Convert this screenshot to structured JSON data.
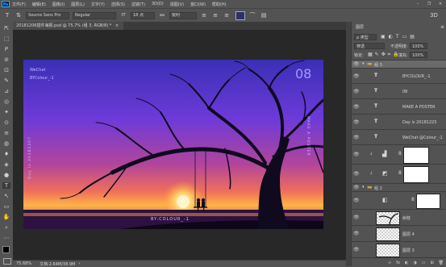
{
  "app": {
    "logo": "Ps"
  },
  "menu": [
    "文件(F)",
    "编辑(E)",
    "图像(I)",
    "图层(L)",
    "文字(Y)",
    "选择(S)",
    "滤镜(T)",
    "3D(D)",
    "视图(V)",
    "窗口(W)",
    "帮助(H)"
  ],
  "window_controls": [
    "–",
    "❐",
    "✕"
  ],
  "options": {
    "tool_icon": "type-tool-icon",
    "font_family": "Source Sans Pro",
    "font_style": "Regular",
    "font_size": "18 点",
    "antialias": "锐利",
    "color_swatch": "#2b2f6b"
  },
  "document_tab": {
    "title": "20181206插件海报.psd @ 75.7% (组 3, RGB/8) *",
    "close": "×"
  },
  "tools": [
    "⇱",
    "⬚",
    "ᑭ",
    "⊘",
    "⊡",
    "✎",
    "⊿",
    "◎",
    "✦",
    "⊙",
    "≡",
    "◍",
    "♦",
    "◈",
    "●",
    "T",
    "↖",
    "▭",
    "✋",
    "⌕",
    "⋯"
  ],
  "poster": {
    "wechat": "WeChat",
    "credit": "BYColour_-1",
    "number": "08",
    "vertical_right": "MAKE A POSTER",
    "vertical_left": "Day is 20181207",
    "bottom_credit": "BY:COLOUR_-1"
  },
  "status": {
    "zoom": "75.68%",
    "doc": "文档:2.64M/38.9M",
    "arrow": "›"
  },
  "layers_panel": {
    "tab": "图层",
    "kind_label": "ρ 类型",
    "blend_mode": "穿透",
    "opacity_label": "不透明度:",
    "opacity": "100%",
    "lock_label": "锁定:",
    "fill_label": "填充:",
    "fill": "100%",
    "group3": "组 3",
    "group2": "组 2",
    "text_layers": [
      "BYCOLOUR_-1",
      "08",
      "MAKE A POSTER",
      "Day is 20181225",
      "WeChat @Colour_-1"
    ],
    "text_symbol": "T",
    "eye": "👁",
    "layer_hand": "树枝",
    "layer4": "图层 4",
    "layer3": "图层 3",
    "footer_icons": [
      "∞",
      "fx",
      "◐",
      "◑",
      "▭",
      "⊞",
      "🗑"
    ]
  }
}
